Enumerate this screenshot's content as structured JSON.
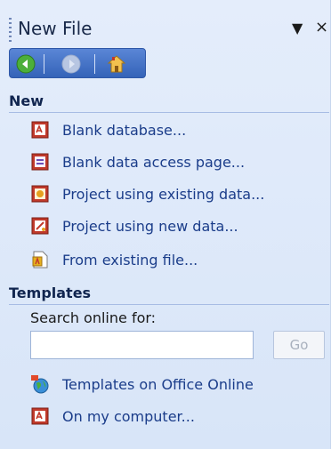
{
  "pane": {
    "title": "New File",
    "dropdown_icon": "dropdown-arrow-icon",
    "close_label": "×"
  },
  "nav": {
    "back_icon": "back-arrow-icon",
    "forward_icon": "forward-arrow-icon",
    "home_icon": "home-icon"
  },
  "new_section": {
    "header": "New",
    "items": [
      {
        "label": "Blank database...",
        "icon": "blank-database-icon"
      },
      {
        "label": "Blank data access page...",
        "icon": "data-access-page-icon"
      },
      {
        "label": "Project using existing data...",
        "icon": "project-existing-data-icon"
      },
      {
        "label": "Project using new data...",
        "icon": "project-new-data-icon"
      },
      {
        "label": "From existing file...",
        "icon": "existing-file-icon"
      }
    ]
  },
  "templates_section": {
    "header": "Templates",
    "search_label": "Search online for:",
    "search_value": "",
    "go_label": "Go",
    "items": [
      {
        "label": "Templates on Office Online",
        "icon": "office-online-globe-icon"
      },
      {
        "label": "On my computer...",
        "icon": "my-computer-template-icon"
      }
    ]
  },
  "colors": {
    "pane_background": "#dce6f8",
    "link_text": "#1b3d8a",
    "header_text": "#10254f",
    "navbar_blue": "#3f6ec4"
  }
}
